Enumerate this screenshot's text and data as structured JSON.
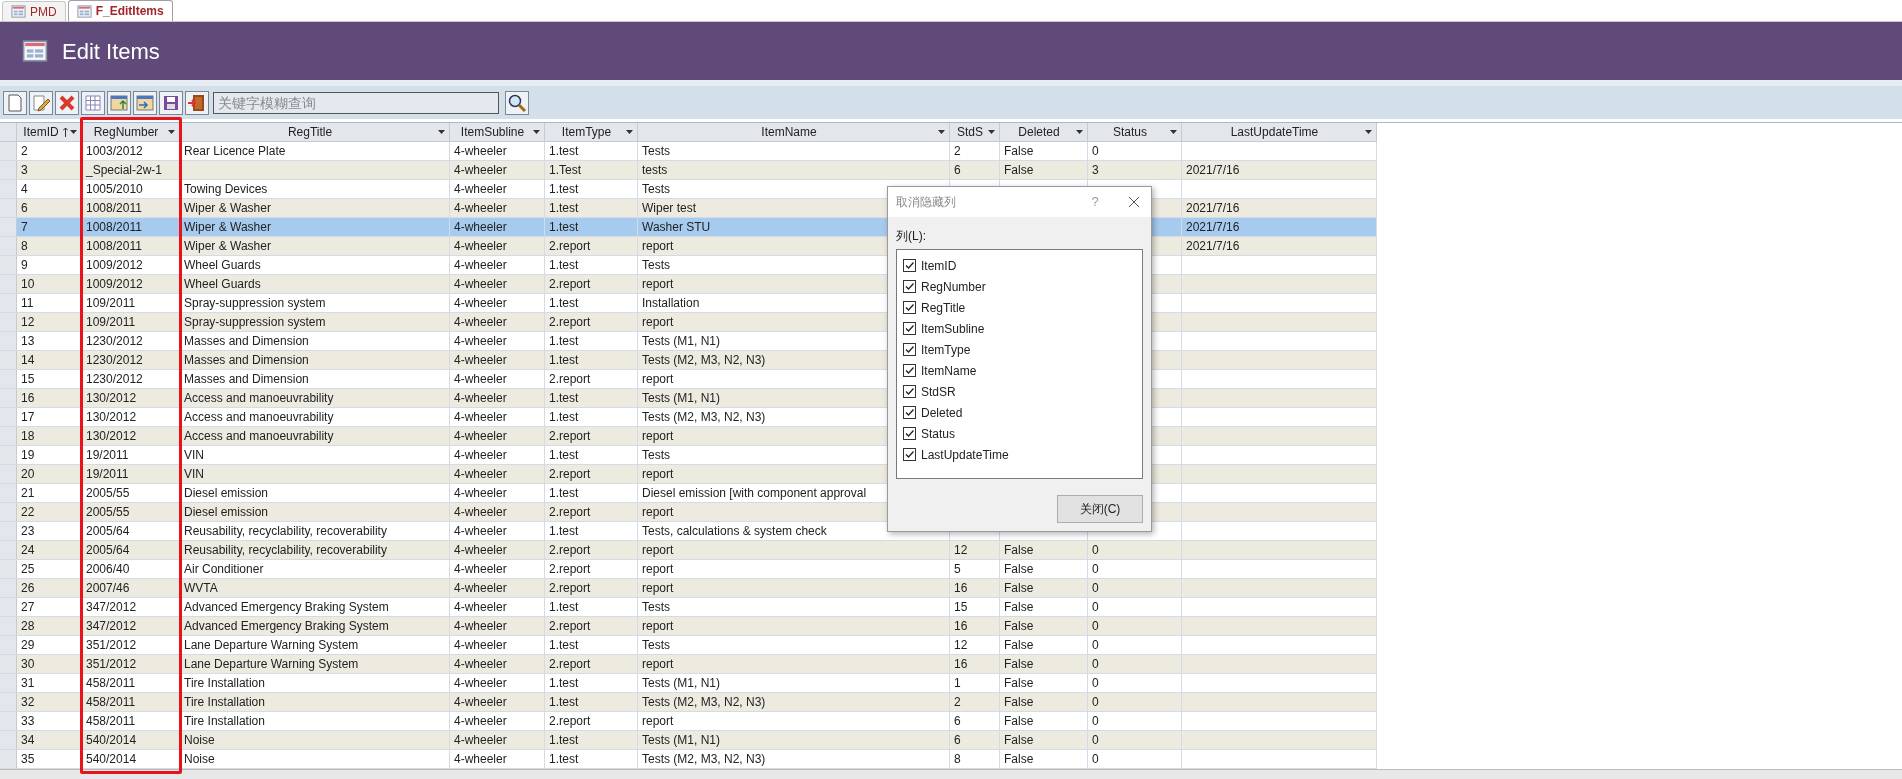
{
  "tabs": [
    {
      "label": "PMD",
      "selected": false
    },
    {
      "label": "F_EditItems",
      "selected": true
    }
  ],
  "header": {
    "title": "Edit Items"
  },
  "toolbar": {
    "search": {
      "placeholder": "关键字模糊查询"
    }
  },
  "table": {
    "columns": [
      {
        "label": "ItemID",
        "sorted": true
      },
      {
        "label": "RegNumber",
        "sorted": false
      },
      {
        "label": "RegTitle",
        "sorted": false
      },
      {
        "label": "ItemSubline",
        "sorted": false
      },
      {
        "label": "ItemType",
        "sorted": false
      },
      {
        "label": "ItemName",
        "sorted": false
      },
      {
        "label": "StdS",
        "sorted": false
      },
      {
        "label": "Deleted",
        "sorted": false
      },
      {
        "label": "Status",
        "sorted": false
      },
      {
        "label": "LastUpdateTime",
        "sorted": false
      }
    ],
    "rows": [
      {
        "selected": false,
        "cells": {
          "item_id": "2",
          "reg_number": "1003/2012",
          "reg_title": "Rear Licence Plate",
          "item_subline": "4-wheeler",
          "item_type": "1.test",
          "item_name": "Tests",
          "std_sr": "2",
          "deleted": "False",
          "status": "0"
        }
      },
      {
        "selected": false,
        "cells": {
          "item_id": "3",
          "reg_number": "_Special-2w-1",
          "item_subline": "4-wheeler",
          "item_type": "1.Test",
          "item_name": "tests",
          "std_sr": "6",
          "deleted": "False",
          "status": "3",
          "last_update_time": "2021/7/16"
        }
      },
      {
        "selected": false,
        "cells": {
          "item_id": "4",
          "reg_number": "1005/2010",
          "reg_title": "Towing Devices",
          "item_subline": "4-wheeler",
          "item_type": "1.test",
          "item_name": "Tests"
        }
      },
      {
        "selected": false,
        "cells": {
          "item_id": "6",
          "reg_number": "1008/2011",
          "reg_title": "Wiper & Washer",
          "item_subline": "4-wheeler",
          "item_type": "1.test",
          "item_name": "Wiper test",
          "last_update_time": "2021/7/16"
        }
      },
      {
        "selected": true,
        "cells": {
          "item_id": "7",
          "reg_number": "1008/2011",
          "reg_title": "Wiper & Washer",
          "item_subline": "4-wheeler",
          "item_type": "1.test",
          "item_name": "Washer STU",
          "last_update_time": "2021/7/16"
        }
      },
      {
        "selected": false,
        "cells": {
          "item_id": "8",
          "reg_number": "1008/2011",
          "reg_title": "Wiper & Washer",
          "item_subline": "4-wheeler",
          "item_type": "2.report",
          "item_name": "report",
          "last_update_time": "2021/7/16"
        }
      },
      {
        "selected": false,
        "cells": {
          "item_id": "9",
          "reg_number": "1009/2012",
          "reg_title": "Wheel Guards",
          "item_subline": "4-wheeler",
          "item_type": "1.test",
          "item_name": "Tests"
        }
      },
      {
        "selected": false,
        "cells": {
          "item_id": "10",
          "reg_number": "1009/2012",
          "reg_title": "Wheel Guards",
          "item_subline": "4-wheeler",
          "item_type": "2.report",
          "item_name": "report"
        }
      },
      {
        "selected": false,
        "cells": {
          "item_id": "11",
          "reg_number": "109/2011",
          "reg_title": "Spray-suppression system",
          "item_subline": "4-wheeler",
          "item_type": "1.test",
          "item_name": "Installation"
        }
      },
      {
        "selected": false,
        "cells": {
          "item_id": "12",
          "reg_number": "109/2011",
          "reg_title": "Spray-suppression system",
          "item_subline": "4-wheeler",
          "item_type": "2.report",
          "item_name": "report"
        }
      },
      {
        "selected": false,
        "cells": {
          "item_id": "13",
          "reg_number": "1230/2012",
          "reg_title": "Masses and Dimension",
          "item_subline": "4-wheeler",
          "item_type": "1.test",
          "item_name": "Tests (M1, N1)"
        }
      },
      {
        "selected": false,
        "cells": {
          "item_id": "14",
          "reg_number": "1230/2012",
          "reg_title": "Masses and Dimension",
          "item_subline": "4-wheeler",
          "item_type": "1.test",
          "item_name": "Tests (M2, M3, N2, N3)"
        }
      },
      {
        "selected": false,
        "cells": {
          "item_id": "15",
          "reg_number": "1230/2012",
          "reg_title": "Masses and Dimension",
          "item_subline": "4-wheeler",
          "item_type": "2.report",
          "item_name": "report"
        }
      },
      {
        "selected": false,
        "cells": {
          "item_id": "16",
          "reg_number": "130/2012",
          "reg_title": "Access and manoeuvrability",
          "item_subline": "4-wheeler",
          "item_type": "1.test",
          "item_name": "Tests (M1, N1)"
        }
      },
      {
        "selected": false,
        "cells": {
          "item_id": "17",
          "reg_number": "130/2012",
          "reg_title": "Access and manoeuvrability",
          "item_subline": "4-wheeler",
          "item_type": "1.test",
          "item_name": "Tests (M2, M3, N2, N3)"
        }
      },
      {
        "selected": false,
        "cells": {
          "item_id": "18",
          "reg_number": "130/2012",
          "reg_title": "Access and manoeuvrability",
          "item_subline": "4-wheeler",
          "item_type": "2.report",
          "item_name": "report"
        }
      },
      {
        "selected": false,
        "cells": {
          "item_id": "19",
          "reg_number": "19/2011",
          "reg_title": "VIN",
          "item_subline": "4-wheeler",
          "item_type": "1.test",
          "item_name": "Tests"
        }
      },
      {
        "selected": false,
        "cells": {
          "item_id": "20",
          "reg_number": "19/2011",
          "reg_title": "VIN",
          "item_subline": "4-wheeler",
          "item_type": "2.report",
          "item_name": "report"
        }
      },
      {
        "selected": false,
        "cells": {
          "item_id": "21",
          "reg_number": "2005/55",
          "reg_title": "Diesel emission",
          "item_subline": "4-wheeler",
          "item_type": "1.test",
          "item_name": "Diesel emission [with component approval"
        }
      },
      {
        "selected": false,
        "cells": {
          "item_id": "22",
          "reg_number": "2005/55",
          "reg_title": "Diesel emission",
          "item_subline": "4-wheeler",
          "item_type": "2.report",
          "item_name": "report"
        }
      },
      {
        "selected": false,
        "cells": {
          "item_id": "23",
          "reg_number": "2005/64",
          "reg_title": "Reusability, recyclability, recoverability",
          "item_subline": "4-wheeler",
          "item_type": "1.test",
          "item_name": "Tests, calculations & system check"
        }
      },
      {
        "selected": false,
        "cells": {
          "item_id": "24",
          "reg_number": "2005/64",
          "reg_title": "Reusability, recyclability, recoverability",
          "item_subline": "4-wheeler",
          "item_type": "2.report",
          "item_name": "report",
          "std_sr": "12",
          "deleted": "False",
          "status": "0"
        }
      },
      {
        "selected": false,
        "cells": {
          "item_id": "25",
          "reg_number": "2006/40",
          "reg_title": "Air Conditioner",
          "item_subline": "4-wheeler",
          "item_type": "2.report",
          "item_name": "report",
          "std_sr": "5",
          "deleted": "False",
          "status": "0"
        }
      },
      {
        "selected": false,
        "cells": {
          "item_id": "26",
          "reg_number": "2007/46",
          "reg_title": "WVTA",
          "item_subline": "4-wheeler",
          "item_type": "2.report",
          "item_name": "report",
          "std_sr": "16",
          "deleted": "False",
          "status": "0"
        }
      },
      {
        "selected": false,
        "cells": {
          "item_id": "27",
          "reg_number": "347/2012",
          "reg_title": "Advanced Emergency Braking System",
          "item_subline": "4-wheeler",
          "item_type": "1.test",
          "item_name": "Tests",
          "std_sr": "15",
          "deleted": "False",
          "status": "0"
        }
      },
      {
        "selected": false,
        "cells": {
          "item_id": "28",
          "reg_number": "347/2012",
          "reg_title": "Advanced Emergency Braking System",
          "item_subline": "4-wheeler",
          "item_type": "2.report",
          "item_name": "report",
          "std_sr": "16",
          "deleted": "False",
          "status": "0"
        }
      },
      {
        "selected": false,
        "cells": {
          "item_id": "29",
          "reg_number": "351/2012",
          "reg_title": "Lane Departure Warning System",
          "item_subline": "4-wheeler",
          "item_type": "1.test",
          "item_name": "Tests",
          "std_sr": "12",
          "deleted": "False",
          "status": "0"
        }
      },
      {
        "selected": false,
        "cells": {
          "item_id": "30",
          "reg_number": "351/2012",
          "reg_title": "Lane Departure Warning System",
          "item_subline": "4-wheeler",
          "item_type": "2.report",
          "item_name": "report",
          "std_sr": "16",
          "deleted": "False",
          "status": "0"
        }
      },
      {
        "selected": false,
        "cells": {
          "item_id": "31",
          "reg_number": "458/2011",
          "reg_title": "Tire Installation",
          "item_subline": "4-wheeler",
          "item_type": "1.test",
          "item_name": "Tests (M1, N1)",
          "std_sr": "1",
          "deleted": "False",
          "status": "0"
        }
      },
      {
        "selected": false,
        "cells": {
          "item_id": "32",
          "reg_number": "458/2011",
          "reg_title": "Tire Installation",
          "item_subline": "4-wheeler",
          "item_type": "1.test",
          "item_name": "Tests (M2, M3, N2, N3)",
          "std_sr": "2",
          "deleted": "False",
          "status": "0"
        }
      },
      {
        "selected": false,
        "cells": {
          "item_id": "33",
          "reg_number": "458/2011",
          "reg_title": "Tire Installation",
          "item_subline": "4-wheeler",
          "item_type": "2.report",
          "item_name": "report",
          "std_sr": "6",
          "deleted": "False",
          "status": "0"
        }
      },
      {
        "selected": false,
        "cells": {
          "item_id": "34",
          "reg_number": "540/2014",
          "reg_title": "Noise",
          "item_subline": "4-wheeler",
          "item_type": "1.test",
          "item_name": "Tests (M1, N1)",
          "std_sr": "6",
          "deleted": "False",
          "status": "0"
        }
      },
      {
        "selected": false,
        "cells": {
          "item_id": "35",
          "reg_number": "540/2014",
          "reg_title": "Noise",
          "item_subline": "4-wheeler",
          "item_type": "1.test",
          "item_name": "Tests (M2, M3, N2, N3)",
          "std_sr": "8",
          "deleted": "False",
          "status": "0"
        }
      }
    ]
  },
  "dialog": {
    "title": "取消隐藏列",
    "help": "?",
    "list_label": "列(L):",
    "items": [
      {
        "label": "ItemID",
        "checked": true
      },
      {
        "label": "RegNumber",
        "checked": true
      },
      {
        "label": "RegTitle",
        "checked": true
      },
      {
        "label": "ItemSubline",
        "checked": true
      },
      {
        "label": "ItemType",
        "checked": true
      },
      {
        "label": "ItemName",
        "checked": true
      },
      {
        "label": "StdSR",
        "checked": true
      },
      {
        "label": "Deleted",
        "checked": true
      },
      {
        "label": "Status",
        "checked": true
      },
      {
        "label": "LastUpdateTime",
        "checked": true
      }
    ],
    "close_button": "关闭(C)"
  }
}
